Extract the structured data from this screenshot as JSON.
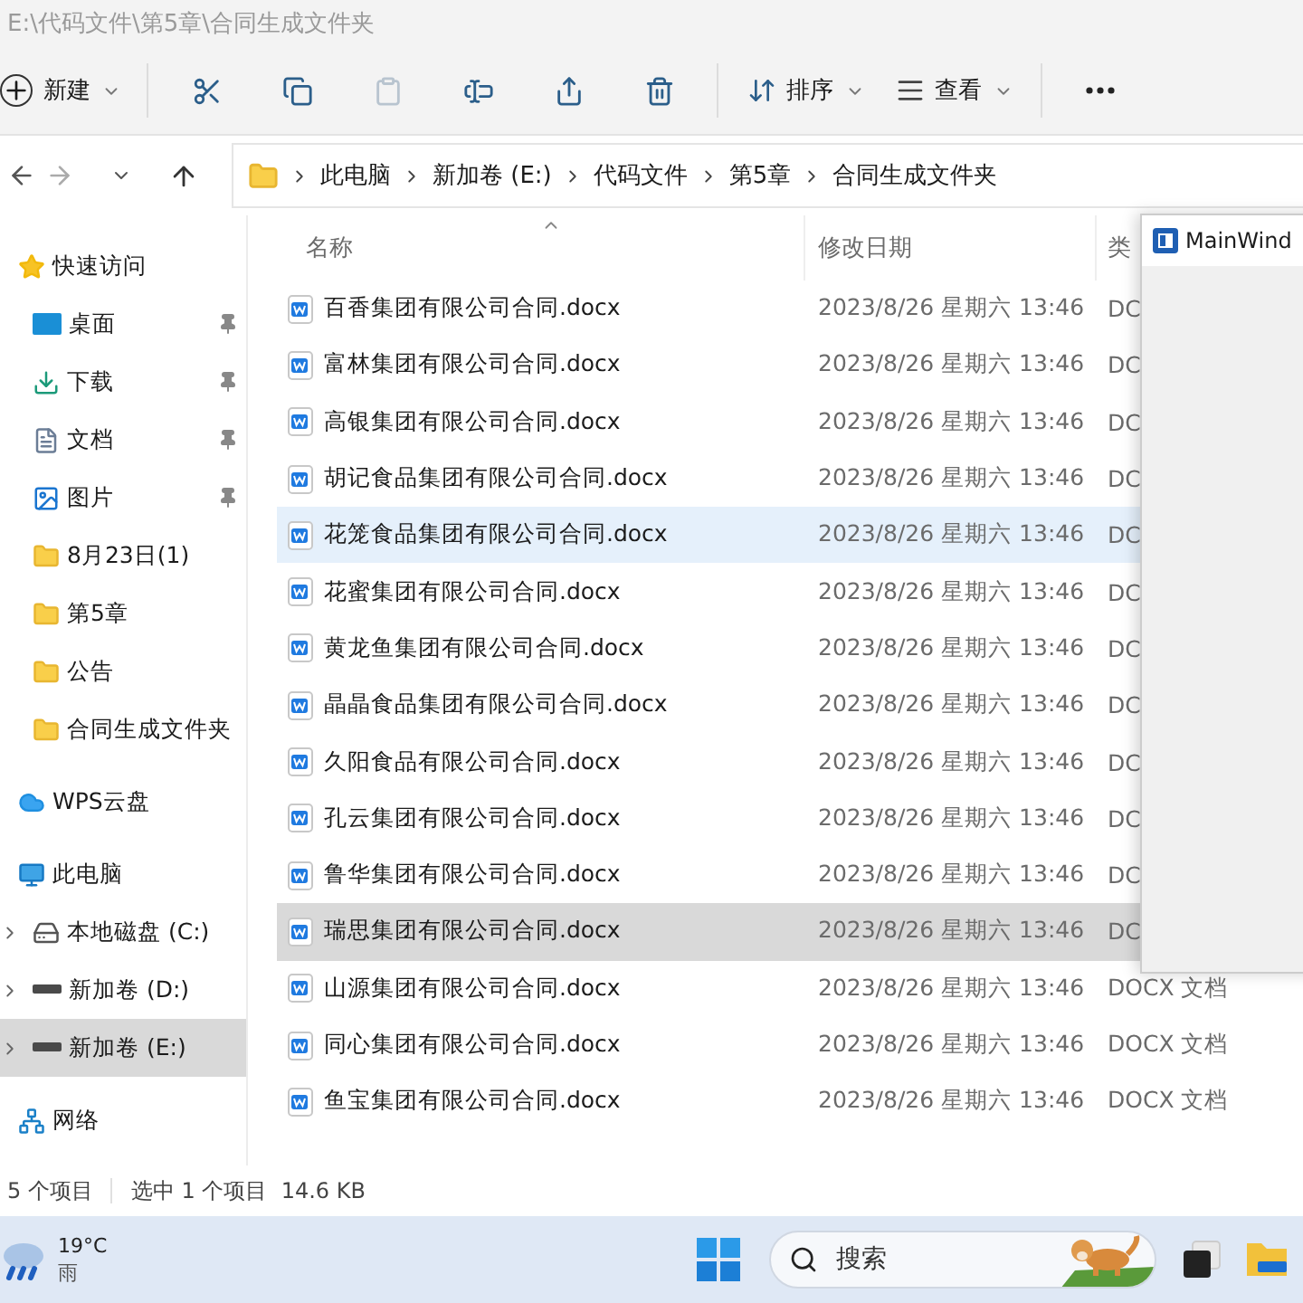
{
  "window": {
    "title": "E:\\代码文件\\第5章\\合同生成文件夹"
  },
  "toolbar": {
    "new_label": "新建",
    "tools": [
      {
        "kind": "cut",
        "disabled": false
      },
      {
        "kind": "copy",
        "disabled": false
      },
      {
        "kind": "paste",
        "disabled": true
      },
      {
        "kind": "rename",
        "disabled": false
      },
      {
        "kind": "share",
        "disabled": false
      },
      {
        "kind": "delete",
        "disabled": false
      }
    ],
    "sort_label": "排序",
    "view_label": "查看"
  },
  "navigation": {
    "forward_disabled": true,
    "breadcrumb": [
      "此电脑",
      "新加卷 (E:)",
      "代码文件",
      "第5章",
      "合同生成文件夹"
    ]
  },
  "sidebar": {
    "items": [
      {
        "kind": "star",
        "label": "快速访问",
        "selected": false,
        "children": [
          {
            "kind": "desktop",
            "label": "桌面",
            "pinned": true,
            "selected": false
          },
          {
            "kind": "download",
            "label": "下载",
            "pinned": true,
            "selected": false
          },
          {
            "kind": "documents",
            "label": "文档",
            "pinned": true,
            "selected": false
          },
          {
            "kind": "pictures",
            "label": "图片",
            "pinned": true,
            "selected": false
          },
          {
            "kind": "folder",
            "label": "8月23日(1)",
            "pinned": false,
            "selected": false
          },
          {
            "kind": "folder",
            "label": "第5章",
            "pinned": false,
            "selected": false
          },
          {
            "kind": "folder",
            "label": "公告",
            "pinned": false,
            "selected": false
          },
          {
            "kind": "folder",
            "label": "合同生成文件夹",
            "pinned": false,
            "selected": false
          }
        ]
      },
      {
        "kind": "cloud",
        "label": "WPS云盘",
        "selected": false
      },
      {
        "kind": "pc",
        "label": "此电脑",
        "selected": false,
        "children": [
          {
            "kind": "system-drive",
            "label": "本地磁盘 (C:)",
            "pinned": false,
            "selected": false
          },
          {
            "kind": "drive",
            "label": "新加卷 (D:)",
            "pinned": false,
            "selected": false
          },
          {
            "kind": "drive",
            "label": "新加卷 (E:)",
            "pinned": false,
            "selected": true
          }
        ]
      },
      {
        "kind": "network",
        "label": "网络",
        "selected": false
      }
    ]
  },
  "file_list": {
    "columns": [
      "名称",
      "修改日期",
      "类"
    ],
    "rows": [
      {
        "name": "百香集团有限公司合同.docx",
        "modified": "2023/8/26 星期六 13:46",
        "type": "DC",
        "hovered": false,
        "selected": false
      },
      {
        "name": "富林集团有限公司合同.docx",
        "modified": "2023/8/26 星期六 13:46",
        "type": "DC",
        "hovered": false,
        "selected": false
      },
      {
        "name": "高银集团有限公司合同.docx",
        "modified": "2023/8/26 星期六 13:46",
        "type": "DC",
        "hovered": false,
        "selected": false
      },
      {
        "name": "胡记食品集团有限公司合同.docx",
        "modified": "2023/8/26 星期六 13:46",
        "type": "DC",
        "hovered": false,
        "selected": false
      },
      {
        "name": "花笼食品集团有限公司合同.docx",
        "modified": "2023/8/26 星期六 13:46",
        "type": "DC",
        "hovered": true,
        "selected": false
      },
      {
        "name": "花蜜集团有限公司合同.docx",
        "modified": "2023/8/26 星期六 13:46",
        "type": "DC",
        "hovered": false,
        "selected": false
      },
      {
        "name": "黄龙鱼集团有限公司合同.docx",
        "modified": "2023/8/26 星期六 13:46",
        "type": "DC",
        "hovered": false,
        "selected": false
      },
      {
        "name": "晶晶食品集团有限公司合同.docx",
        "modified": "2023/8/26 星期六 13:46",
        "type": "DC",
        "hovered": false,
        "selected": false
      },
      {
        "name": "久阳食品有限公司合同.docx",
        "modified": "2023/8/26 星期六 13:46",
        "type": "DC",
        "hovered": false,
        "selected": false
      },
      {
        "name": "孔云集团有限公司合同.docx",
        "modified": "2023/8/26 星期六 13:46",
        "type": "DC",
        "hovered": false,
        "selected": false
      },
      {
        "name": "鲁华集团有限公司合同.docx",
        "modified": "2023/8/26 星期六 13:46",
        "type": "DC",
        "hovered": false,
        "selected": false
      },
      {
        "name": "瑞思集团有限公司合同.docx",
        "modified": "2023/8/26 星期六 13:46",
        "type": "DC",
        "hovered": false,
        "selected": true
      },
      {
        "name": "山源集团有限公司合同.docx",
        "modified": "2023/8/26 星期六 13:46",
        "type": "DOCX 文档",
        "hovered": false,
        "selected": false
      },
      {
        "name": "同心集团有限公司合同.docx",
        "modified": "2023/8/26 星期六 13:46",
        "type": "DOCX 文档",
        "hovered": false,
        "selected": false
      },
      {
        "name": "鱼宝集团有限公司合同.docx",
        "modified": "2023/8/26 星期六 13:46",
        "type": "DOCX 文档",
        "hovered": false,
        "selected": false
      }
    ]
  },
  "status_bar": {
    "item_count": "5 个项目",
    "selection": "选中 1 个项目  14.6 KB"
  },
  "overlay_window": {
    "title": "MainWind"
  },
  "taskbar": {
    "temperature": "19°C",
    "weather": "雨",
    "search_placeholder": "搜索"
  }
}
